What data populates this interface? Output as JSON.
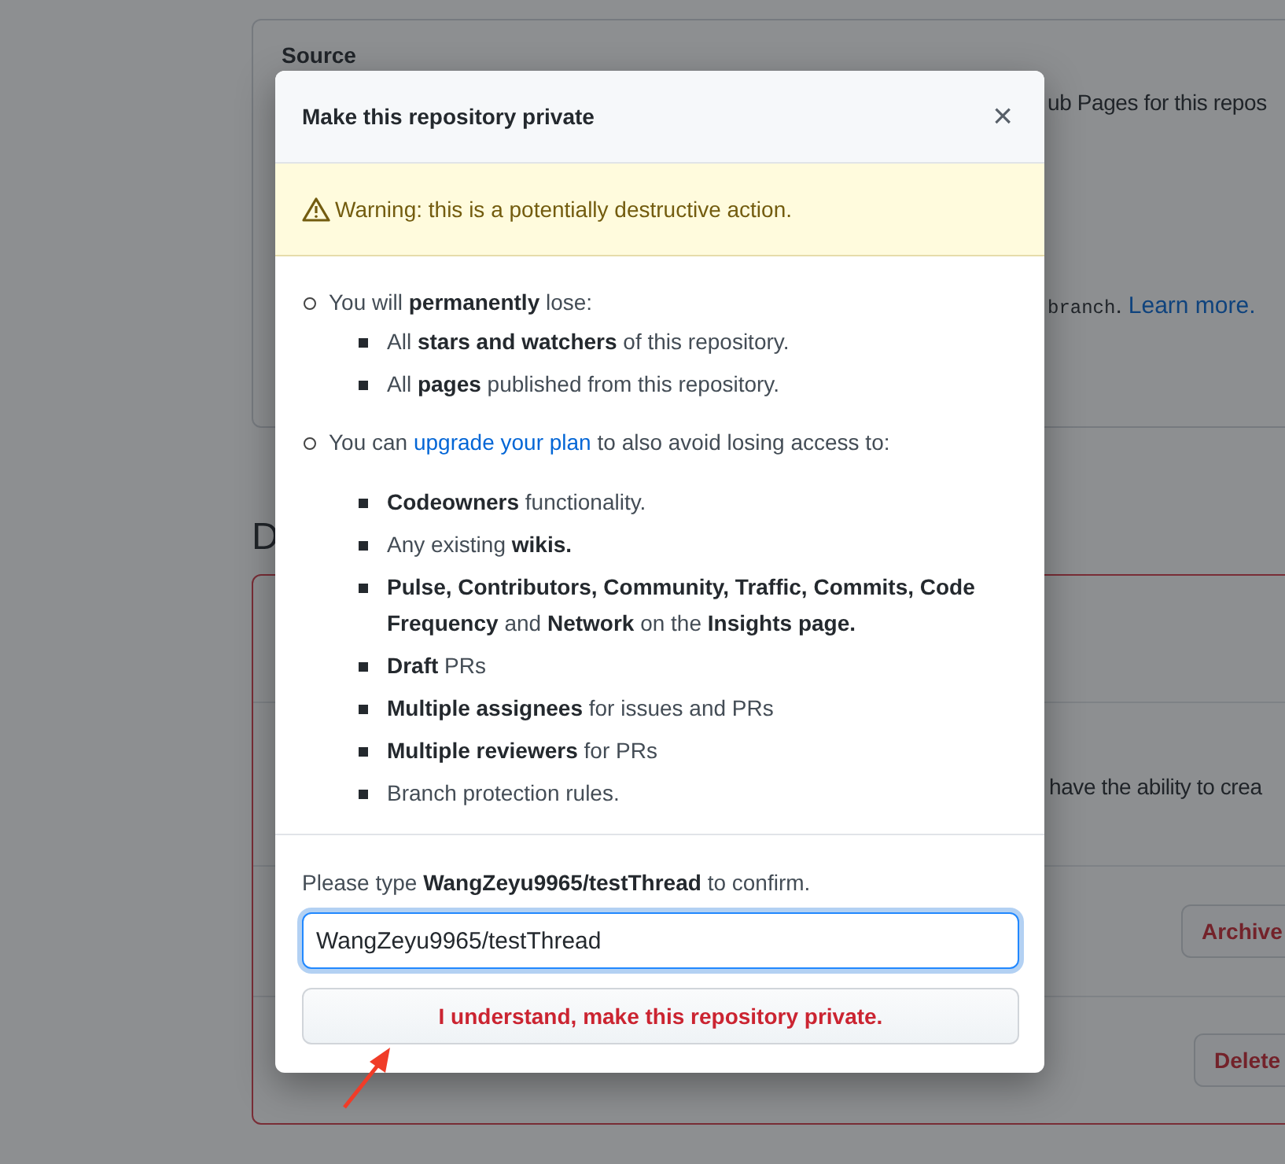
{
  "background": {
    "source_label": "Source",
    "pages_text": "ub Pages for this repos",
    "branch_code": "branch",
    "branch_period": ".",
    "learn_more": "Learn more.",
    "danger_heading": "D",
    "danger_text": "have the ability to crea",
    "archive_button": "Archive",
    "delete_button": "Delete"
  },
  "dialog": {
    "title": "Make this repository private",
    "close": "×",
    "warning": "Warning: this is a potentially destructive action.",
    "sections": [
      {
        "text_before": "You will **permanently** lose:",
        "items": [
          "All **stars and watchers** of this repository.",
          "All **pages** published from this repository."
        ]
      },
      {
        "text_before": "You can ",
        "link": "upgrade your plan",
        "text_after": " to also avoid losing access to:",
        "items": [
          "**Codeowners** functionality.",
          "Any existing **wikis.**",
          "**Pulse, Contributors, Community, Traffic, Commits, Code Frequency** and **Network** on the **Insights page.**",
          "**Draft** PRs",
          "**Multiple assignees** for issues and PRs",
          "**Multiple reviewers** for PRs",
          "Branch protection rules."
        ]
      }
    ],
    "confirm_prompt": "Please type **WangZeyu9965/testThread** to confirm.",
    "input_value": "WangZeyu9965/testThread",
    "confirm_button": "I understand, make this repository private."
  },
  "annotations": [
    {
      "kind": "arrow"
    }
  ]
}
